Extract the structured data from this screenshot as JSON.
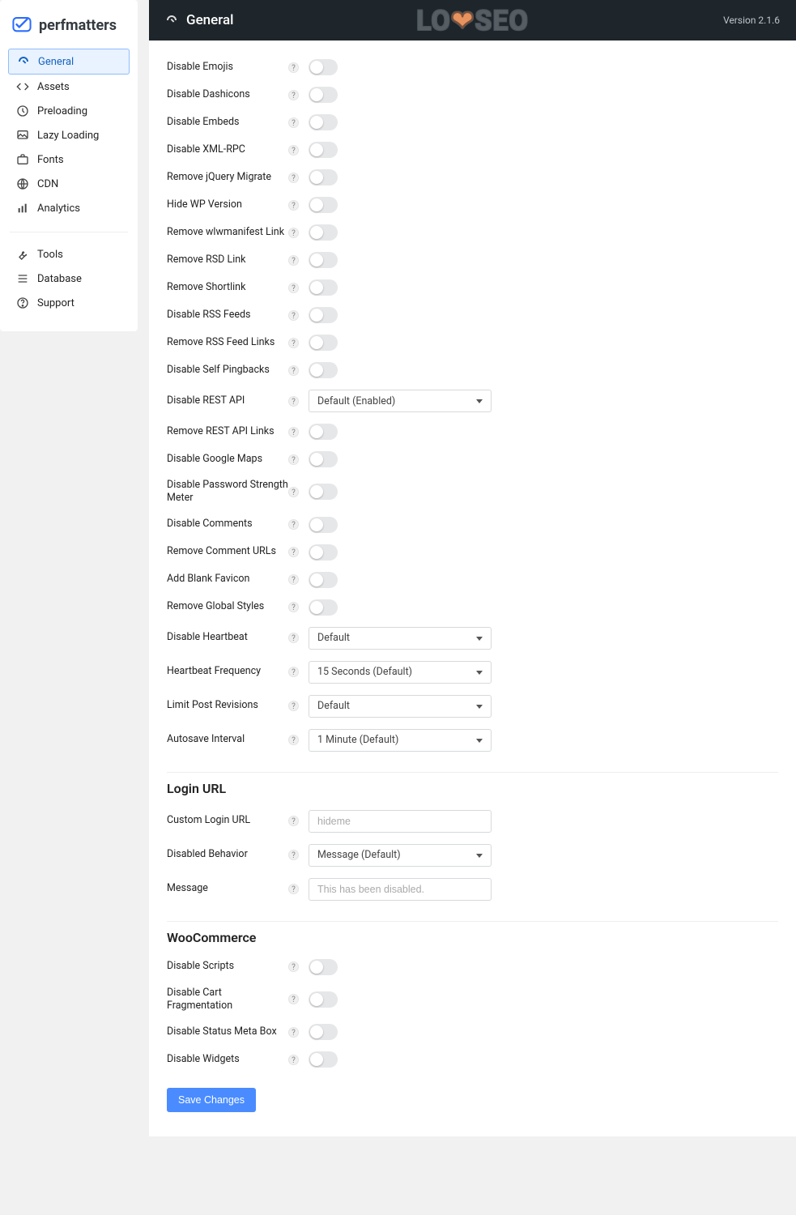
{
  "brand": {
    "name": "perfmatters"
  },
  "sidebar": {
    "items": [
      {
        "label": "General",
        "icon": "gauge-icon",
        "active": true
      },
      {
        "label": "Assets",
        "icon": "code-icon",
        "active": false
      },
      {
        "label": "Preloading",
        "icon": "clock-icon",
        "active": false
      },
      {
        "label": "Lazy Loading",
        "icon": "image-icon",
        "active": false
      },
      {
        "label": "Fonts",
        "icon": "briefcase-icon",
        "active": false
      },
      {
        "label": "CDN",
        "icon": "globe-icon",
        "active": false
      },
      {
        "label": "Analytics",
        "icon": "bar-chart-icon",
        "active": false
      }
    ],
    "items2": [
      {
        "label": "Tools",
        "icon": "wrench-icon",
        "active": false
      },
      {
        "label": "Database",
        "icon": "list-icon",
        "active": false
      },
      {
        "label": "Support",
        "icon": "question-icon",
        "active": false
      }
    ]
  },
  "header": {
    "title": "General",
    "version": "Version 2.1.6",
    "watermark": "LOYSEO"
  },
  "general": {
    "rows_a": [
      {
        "label": "Disable Emojis",
        "type": "toggle"
      },
      {
        "label": "Disable Dashicons",
        "type": "toggle"
      },
      {
        "label": "Disable Embeds",
        "type": "toggle"
      },
      {
        "label": "Disable XML-RPC",
        "type": "toggle"
      },
      {
        "label": "Remove jQuery Migrate",
        "type": "toggle"
      },
      {
        "label": "Hide WP Version",
        "type": "toggle"
      },
      {
        "label": "Remove wlwmanifest Link",
        "type": "toggle"
      },
      {
        "label": "Remove RSD Link",
        "type": "toggle"
      },
      {
        "label": "Remove Shortlink",
        "type": "toggle"
      },
      {
        "label": "Disable RSS Feeds",
        "type": "toggle"
      },
      {
        "label": "Remove RSS Feed Links",
        "type": "toggle"
      },
      {
        "label": "Disable Self Pingbacks",
        "type": "toggle"
      },
      {
        "label": "Disable REST API",
        "type": "select",
        "value": "Default (Enabled)"
      },
      {
        "label": "Remove REST API Links",
        "type": "toggle"
      },
      {
        "label": "Disable Google Maps",
        "type": "toggle"
      },
      {
        "label": "Disable Password Strength Meter",
        "type": "toggle"
      },
      {
        "label": "Disable Comments",
        "type": "toggle"
      },
      {
        "label": "Remove Comment URLs",
        "type": "toggle"
      },
      {
        "label": "Add Blank Favicon",
        "type": "toggle"
      },
      {
        "label": "Remove Global Styles",
        "type": "toggle"
      },
      {
        "label": "Disable Heartbeat",
        "type": "select",
        "value": "Default"
      },
      {
        "label": "Heartbeat Frequency",
        "type": "select",
        "value": "15 Seconds (Default)"
      },
      {
        "label": "Limit Post Revisions",
        "type": "select",
        "value": "Default"
      },
      {
        "label": "Autosave Interval",
        "type": "select",
        "value": "1 Minute (Default)"
      }
    ]
  },
  "login": {
    "title": "Login URL",
    "rows": [
      {
        "label": "Custom Login URL",
        "type": "text",
        "placeholder": "hideme"
      },
      {
        "label": "Disabled Behavior",
        "type": "select",
        "value": "Message (Default)"
      },
      {
        "label": "Message",
        "type": "text",
        "placeholder": "This has been disabled."
      }
    ]
  },
  "woocommerce": {
    "title": "WooCommerce",
    "rows": [
      {
        "label": "Disable Scripts",
        "type": "toggle"
      },
      {
        "label": "Disable Cart Fragmentation",
        "type": "toggle"
      },
      {
        "label": "Disable Status Meta Box",
        "type": "toggle"
      },
      {
        "label": "Disable Widgets",
        "type": "toggle"
      }
    ]
  },
  "actions": {
    "save": "Save Changes"
  },
  "help_char": "?"
}
